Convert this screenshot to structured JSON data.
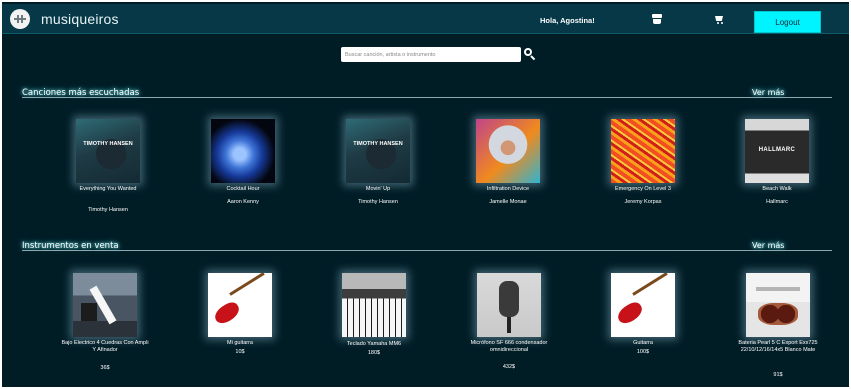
{
  "app": {
    "brand": "musiqueiros"
  },
  "header": {
    "greeting": "Hola, Agostina!",
    "logout_label": "Logout"
  },
  "search": {
    "placeholder": "Buscar canción, artista o instrumento"
  },
  "songs_section": {
    "title": "Canciones más escuchadas",
    "more_label": "Ver más",
    "items": [
      {
        "title": "Everything You Wanted",
        "artist": "Timothy Hansen",
        "cover_text": "TIMOTHY HANSEN"
      },
      {
        "title": "Cocktail Hour",
        "artist": "Aaron Kenny"
      },
      {
        "title": "Movin' Up",
        "artist": "Timothy Hansen",
        "cover_text": "TIMOTHY HANSEN"
      },
      {
        "title": "Infiltration Device",
        "artist": "Jamelle Monae"
      },
      {
        "title": "Emergency On Level 3",
        "artist": "Jeremy Korpas"
      },
      {
        "title": "Beach Walk",
        "artist": "Hallmarc",
        "cover_text": "HALLMARC"
      }
    ]
  },
  "instruments_section": {
    "title": "Instrumentos en venta",
    "more_label": "Ver más",
    "items": [
      {
        "name": "Bajo Electrico 4 Cuedras Con Ampli Y Afinador",
        "price": "36$"
      },
      {
        "name": "Mi guitarra",
        "price": "10$"
      },
      {
        "name": "Teclado Yamaha MM6",
        "price": "180$"
      },
      {
        "name": "Micrófono SF 666 condensador omnidireccional",
        "price": "432$"
      },
      {
        "name": "Guitarra",
        "price": "100$"
      },
      {
        "name": "Bateria Pearl 5 C Export Exx725 22/10/12/16/14x5 Blanco Mate",
        "price": "91$"
      }
    ]
  }
}
